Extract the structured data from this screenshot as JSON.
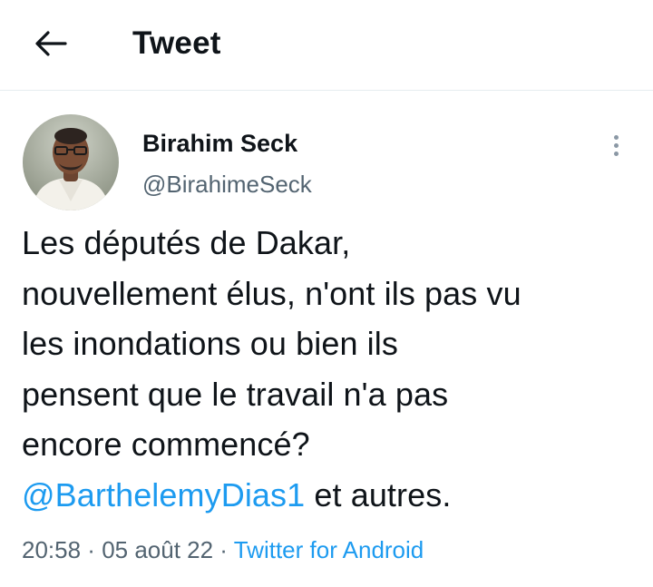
{
  "header": {
    "back_icon": "arrow-left-icon",
    "title": "Tweet"
  },
  "tweet": {
    "author": {
      "display_name": "Birahim Seck",
      "handle": "@BirahimeSeck",
      "avatar_icon": "profile-photo"
    },
    "more_icon": "vertical-ellipsis-icon",
    "text_lines": [
      "Les députés de Dakar,",
      "nouvellement élus, n'ont ils pas vu",
      "les inondations ou bien ils",
      "pensent que le travail n'a pas",
      "encore commencé?"
    ],
    "mention": "@BarthelemyDias1",
    "mention_suffix": " et autres.",
    "meta": {
      "time": "20:58",
      "separator": " · ",
      "date": "05 août 22",
      "source": "Twitter for Android"
    }
  },
  "colors": {
    "accent": "#1d9bf0",
    "secondary_text": "#536471",
    "divider": "#e6ecf0"
  }
}
